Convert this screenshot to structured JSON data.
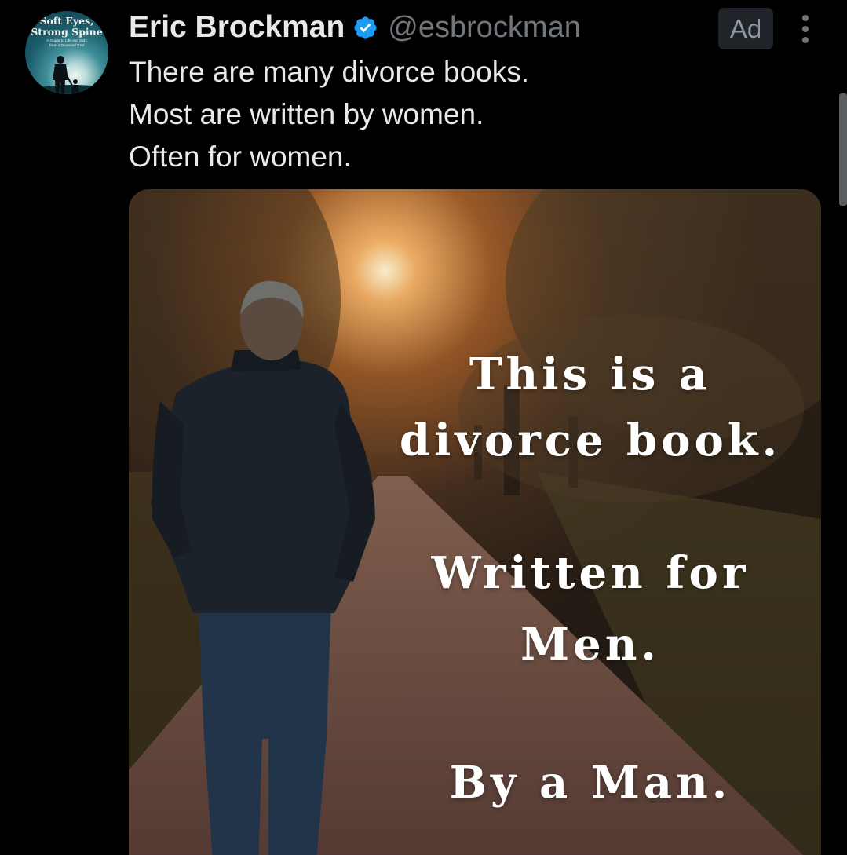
{
  "account": {
    "display_name": "Eric Brockman",
    "handle": "@esbrockman",
    "verified": true,
    "avatar": {
      "title_line_1": "Soft Eyes,",
      "title_line_2": "Strong Spine",
      "subtitle_lines": [
        "A Guide to Life and Kids",
        "from a Divorced Dad"
      ]
    }
  },
  "badge": {
    "label": "Ad"
  },
  "icons": {
    "verified": "verified-badge-icon",
    "more": "more-options-icon"
  },
  "tweet": {
    "lines": [
      "There are many divorce books.",
      "Most are written by women.",
      "Often for women."
    ]
  },
  "media": {
    "overlay_lines": [
      "This is a",
      "divorce book.",
      "Written for",
      "Men.",
      "By a Man."
    ]
  },
  "colors": {
    "background": "#000000",
    "text_primary": "#e7e9ea",
    "text_secondary": "#71767b",
    "verified_blue": "#1d9bf0",
    "ad_badge_bg": "#202327"
  }
}
